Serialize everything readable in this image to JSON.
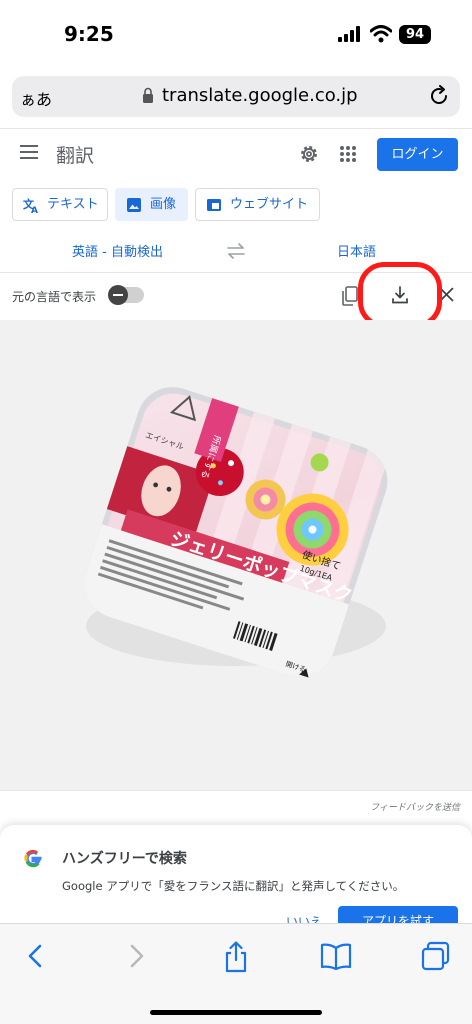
{
  "status": {
    "time": "9:25",
    "battery": "94"
  },
  "browser": {
    "aa_label": "ぁあ",
    "url": "translate.google.co.jp"
  },
  "header": {
    "title": "翻訳",
    "login_label": "ログイン"
  },
  "tabs": [
    {
      "label": "テキスト"
    },
    {
      "label": "画像"
    },
    {
      "label": "ウェブサイト"
    }
  ],
  "languages": {
    "source": "英語 - 自動検出",
    "target": "日本語"
  },
  "toolbar_row": {
    "show_original_label": "元の言語で表示"
  },
  "product_image": {
    "texts": [
      "所属にする",
      "エイシャル",
      "ジェリーポップマスク",
      "使い捨て",
      "10g/1EA",
      "開ける"
    ]
  },
  "feedback_label": "フィードバックを送信",
  "handsfree_card": {
    "title": "ハンズフリーで検索",
    "body": "Google アプリで「愛をフランス語に翻訳」と発声してください。",
    "no_label": "いいえ",
    "try_label": "アプリを試す"
  },
  "colors": {
    "accent": "#1a73e8",
    "highlight": "#ff1a1a"
  }
}
